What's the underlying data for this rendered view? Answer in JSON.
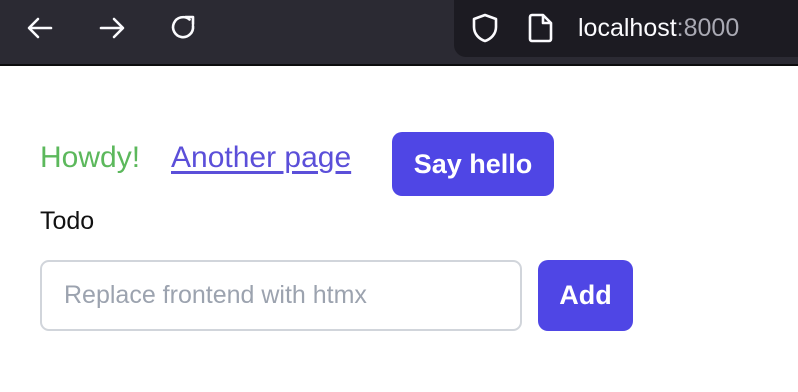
{
  "browser": {
    "url_host": "localhost",
    "url_port": ":8000",
    "icons": {
      "back": "back-arrow-icon",
      "forward": "forward-arrow-icon",
      "reload": "reload-icon",
      "tracking": "shield-icon",
      "page": "page-icon"
    }
  },
  "page": {
    "howdy_text": "Howdy!",
    "another_page_link": "Another page",
    "say_hello_button": "Say hello",
    "todo_heading": "Todo",
    "todo_input": {
      "value": "",
      "placeholder": "Replace frontend with htmx"
    },
    "add_button": "Add"
  },
  "colors": {
    "accent": "#4f46e5",
    "howdy_green": "#5cb85c",
    "link": "#5b4fd9",
    "toolbar_bg": "#2b2a33",
    "urlbar_bg": "#1c1b22"
  }
}
